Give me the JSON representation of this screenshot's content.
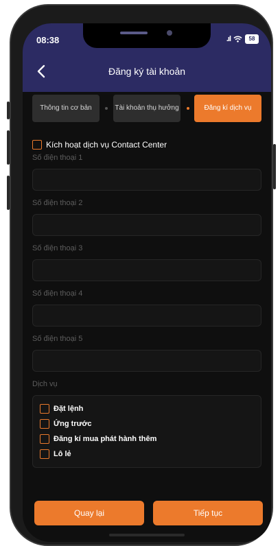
{
  "status_bar": {
    "time": "08:38",
    "signal": ".ıl",
    "wifi": "wifi-icon",
    "battery": "58"
  },
  "header": {
    "title": "Đăng ký tài khoản",
    "back_icon": "chevron-left-icon"
  },
  "steps": [
    {
      "label": "Thông tin cơ bản",
      "active": false
    },
    {
      "label": "Tài khoản thụ hưởng",
      "active": false
    },
    {
      "label": "Đăng kí dịch vụ",
      "active": true
    }
  ],
  "form": {
    "contact_center_label": "Kích hoạt dịch vụ Contact Center",
    "phone_fields": [
      {
        "label": "Số điện thoại 1",
        "value": ""
      },
      {
        "label": "Số điện thoại 2",
        "value": ""
      },
      {
        "label": "Số điện thoại 3",
        "value": ""
      },
      {
        "label": "Số điện thoại 4",
        "value": ""
      },
      {
        "label": "Số điện thoại 5",
        "value": ""
      }
    ],
    "services_label": "Dịch vụ",
    "services": [
      {
        "label": "Đặt lệnh",
        "checked": false
      },
      {
        "label": "Ứng trước",
        "checked": false
      },
      {
        "label": "Đăng kí mua phát hành thêm",
        "checked": false
      },
      {
        "label": "Lô lẻ",
        "checked": false
      }
    ]
  },
  "footer": {
    "back_label": "Quay lại",
    "next_label": "Tiếp tục"
  },
  "colors": {
    "accent": "#ec7a2c",
    "header_bg": "#2c2b63",
    "background": "#0f0f0f"
  }
}
